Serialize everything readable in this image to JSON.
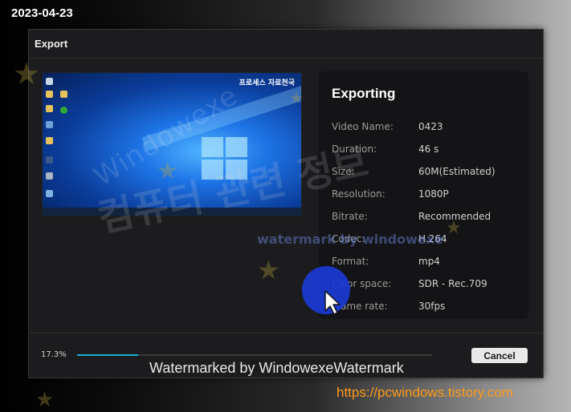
{
  "date_stamp": "2023-04-23",
  "dialog": {
    "title": "Export",
    "preview_overlay_text": "프로세스 자료천국",
    "info": {
      "heading": "Exporting",
      "rows": [
        {
          "label": "Video Name:",
          "value": "0423"
        },
        {
          "label": "Duration:",
          "value": "46 s"
        },
        {
          "label": "Size:",
          "value": "60M(Estimated)"
        },
        {
          "label": "Resolution:",
          "value": "1080P"
        },
        {
          "label": "Bitrate:",
          "value": "Recommended"
        },
        {
          "label": "Codec:",
          "value": "H.264"
        },
        {
          "label": "Format:",
          "value": "mp4"
        },
        {
          "label": "Color space:",
          "value": "SDR - Rec.709"
        },
        {
          "label": "Frame rate:",
          "value": "30fps"
        }
      ]
    },
    "progress": {
      "percent_text": "17.3%",
      "fraction": 0.173
    },
    "cancel_label": "Cancel"
  },
  "watermarks": {
    "diagonal": "Windowexe",
    "korean": "컴퓨터 관련 정보",
    "mid": "watermark by windowexe",
    "bottom": "Watermarked by WindowexeWatermark"
  },
  "site_url": "https://pcwindows.tistory.com",
  "colors": {
    "progress_accent": "#18b0d8",
    "url_orange": "#ff9a1a",
    "cursor_blob": "#1a3ad4"
  }
}
